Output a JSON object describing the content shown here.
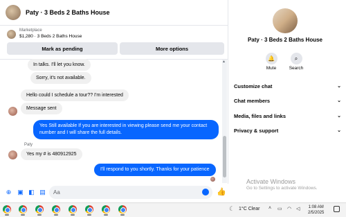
{
  "header": {
    "title": "Paty · 3 Beds 2 Baths House"
  },
  "marketplace": {
    "label": "Marketplace",
    "listing": "$1,280 · 3 Beds 2 Baths House",
    "mark_pending_label": "Mark as pending",
    "more_options_label": "More options"
  },
  "messages": [
    {
      "dir": "in",
      "text": "In talks. I'll let you know."
    },
    {
      "dir": "in",
      "text": "Sorry, it's not available."
    },
    {
      "dir": "in",
      "text": "Hello could I schedule a tour?? I'm interested"
    },
    {
      "dir": "in",
      "text": "Message sent"
    },
    {
      "dir": "out",
      "text": "Yes Still available If you are interested in viewing please send me your contact number and I will share the full details."
    },
    {
      "dir": "in",
      "sender": "Paty",
      "text": "Yes my # is 480912925"
    },
    {
      "dir": "out",
      "text": "I'll respond to you shortly. Thanks for your patience"
    }
  ],
  "composer": {
    "placeholder": "Aa"
  },
  "side": {
    "title": "Paty · 3 Beds 2 Baths House",
    "actions": [
      {
        "label": "Mute",
        "icon": "bell-icon"
      },
      {
        "label": "Search",
        "icon": "search-icon"
      }
    ],
    "sections": [
      "Customize chat",
      "Chat members",
      "Media, files and links",
      "Privacy & support"
    ]
  },
  "watermark": {
    "line1": "Activate Windows",
    "line2": "Go to Settings to activate Windows."
  },
  "taskbar": {
    "weather": "1°C  Clear",
    "time": "1:08 AM",
    "date": "2/5/2025"
  },
  "colors": {
    "accent": "#0866ff",
    "bubble_in": "#f0f0f0"
  }
}
